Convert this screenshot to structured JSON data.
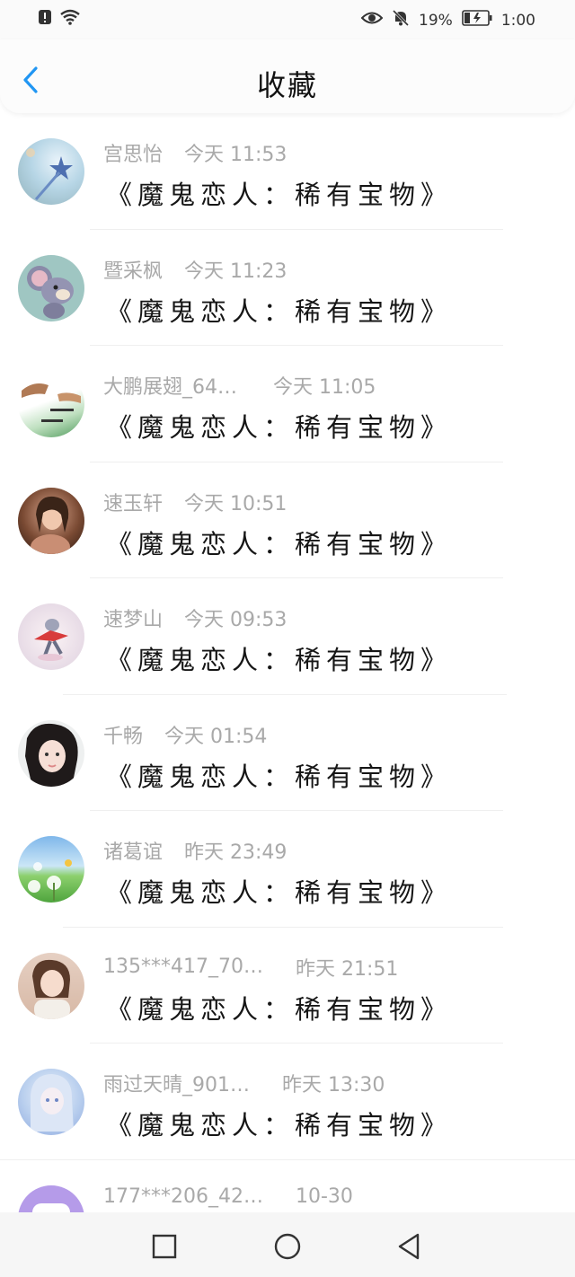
{
  "status": {
    "battery": "19%",
    "time": "1:00"
  },
  "header": {
    "title": "收藏"
  },
  "items": [
    {
      "name": "宫思怡",
      "time": "今天 11:53",
      "content": "《魔鬼恋人：稀有宝物》"
    },
    {
      "name": "暨采枫",
      "time": "今天 11:23",
      "content": "《魔鬼恋人：稀有宝物》"
    },
    {
      "name": "大鹏展翅_64…",
      "time": "今天 11:05",
      "content": "《魔鬼恋人：稀有宝物》"
    },
    {
      "name": "速玉轩",
      "time": "今天 10:51",
      "content": "《魔鬼恋人：稀有宝物》"
    },
    {
      "name": "速梦山",
      "time": "今天 09:53",
      "content": "《魔鬼恋人：稀有宝物》"
    },
    {
      "name": "千畅",
      "time": "今天 01:54",
      "content": "《魔鬼恋人：稀有宝物》"
    },
    {
      "name": "诸葛谊",
      "time": "昨天 23:49",
      "content": "《魔鬼恋人：稀有宝物》"
    },
    {
      "name": "135***417_70…",
      "time": "昨天 21:51",
      "content": "《魔鬼恋人：稀有宝物》"
    },
    {
      "name": "雨过天晴_901…",
      "time": "昨天 13:30",
      "content": "《魔鬼恋人：稀有宝物》"
    },
    {
      "name": "177***206_42…",
      "time": "10-30",
      "content": ""
    }
  ],
  "colors": {
    "accent": "#2196f3",
    "name": "#a9a9a9",
    "text": "#161616"
  }
}
